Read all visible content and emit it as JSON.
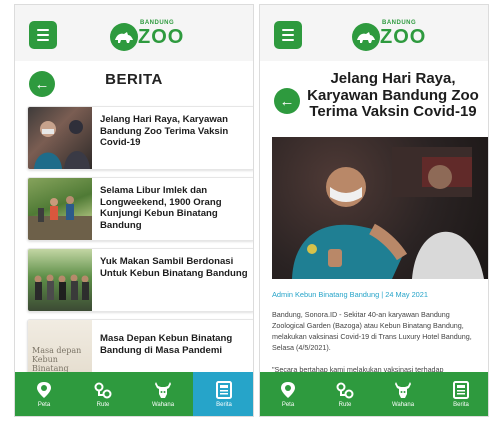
{
  "brand": {
    "top": "BANDUNG",
    "name": "ZOO",
    "color": "#2e9a3e"
  },
  "colors": {
    "primary": "#2e9a3e",
    "nav_active": "#26a4c9",
    "link": "#26a4c9"
  },
  "list_screen": {
    "title": "BERITA",
    "articles": [
      {
        "title": "Jelang Hari Raya, Karyawan Bandung Zoo Terima Vaksin Covid-19"
      },
      {
        "title": "Selama Libur Imlek dan Longweekend, 1900 Orang Kunjungi Kebun Binatang Bandung"
      },
      {
        "title": "Yuk Makan Sambil Berdonasi Untuk Kebun Binatang Bandung"
      },
      {
        "title": "Masa Depan Kebun Binatang Bandung di Masa Pandemi",
        "thumb_text": "Masa depan Kebun Binatang Bandung di"
      }
    ]
  },
  "detail_screen": {
    "title": "Jelang Hari Raya, Karyawan Bandung Zoo Terima Vaksin Covid-19",
    "byline": "Admin Kebun Binatang Bandung | 24 May 2021",
    "paragraphs": [
      "Bandung, Sonora.ID - Sekitar 40-an karyawan Bandung Zoological Garden (Bazoga) atau Kebun Binatang Bandung, melakukan vaksinasi Covid-19 di Trans Luxury Hotel Bandung, Selasa (4/5/2021).",
      "\"Secara bertahap kami melakukan vaksinasi terhadap"
    ]
  },
  "nav": {
    "items": [
      {
        "label": "Peta",
        "icon": "map-pin-icon"
      },
      {
        "label": "Rute",
        "icon": "route-icon"
      },
      {
        "label": "Wahana",
        "icon": "deer-icon"
      },
      {
        "label": "Berita",
        "icon": "news-icon",
        "active": true
      }
    ]
  }
}
